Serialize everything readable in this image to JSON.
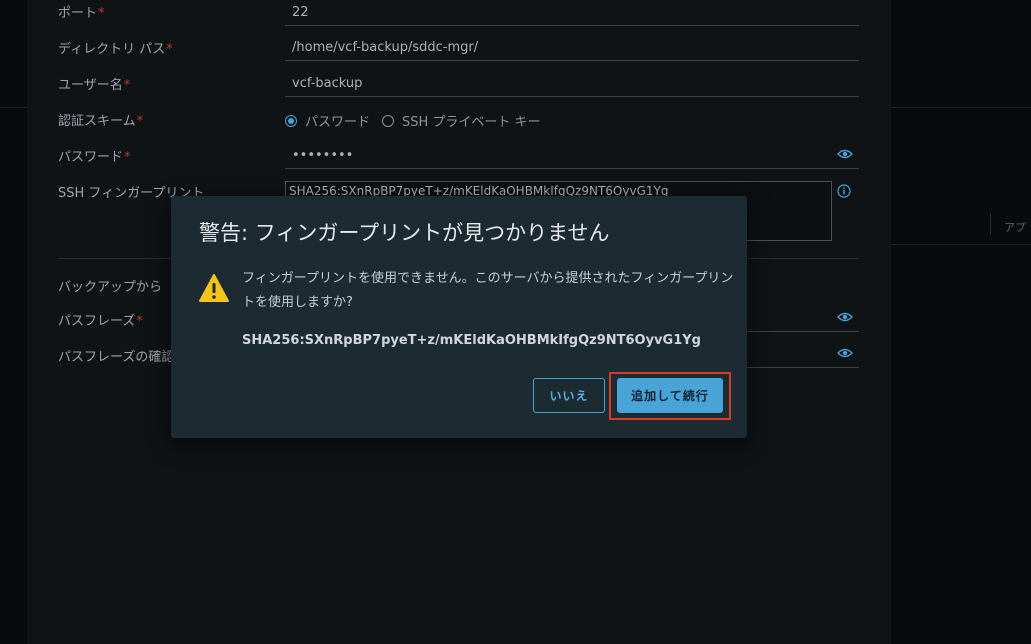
{
  "form": {
    "port": {
      "label": "ポート",
      "value": "22"
    },
    "directory_path": {
      "label": "ディレクトリ パス",
      "value": "/home/vcf-backup/sddc-mgr/"
    },
    "username": {
      "label": "ユーザー名",
      "value": "vcf-backup"
    },
    "auth_scheme": {
      "label": "認証スキーム",
      "option_password": "パスワード",
      "option_ssh_key": "SSH プライベート キー",
      "selected": "パスワード"
    },
    "password": {
      "label": "パスワード",
      "value": "••••••••"
    },
    "ssh_fingerprint": {
      "label": "SSH フィンガープリント",
      "value": "SHA256:SXnRpBP7pyeT+z/mKEldKaOHBMkIfgQz9NT6OyvG1Yg"
    },
    "backup_section_label": "バックアップから",
    "passphrase": {
      "label": "パスフレーズ"
    },
    "passphrase_confirm": {
      "label": "パスフレーズの確認"
    },
    "required_mark": "*"
  },
  "side_label": "アプ",
  "dialog": {
    "title": "警告: フィンガープリントが見つかりません",
    "message": "フィンガープリントを使用できません。このサーバから提供されたフィンガープリントを使用しますか?",
    "fingerprint": "SHA256:SXnRpBP7pyeT+z/mKEldKaOHBMkIfgQz9NT6OyvG1Yg",
    "cancel_label": "いいえ",
    "confirm_label": "追加して続行"
  },
  "colors": {
    "accent": "#48a3d6",
    "warning": "#f5c518",
    "highlight_frame": "#d93a24",
    "required": "#b83a2f"
  },
  "icons": {
    "warning": "warning-triangle-icon",
    "eye": "eye-icon",
    "info": "info-icon"
  }
}
